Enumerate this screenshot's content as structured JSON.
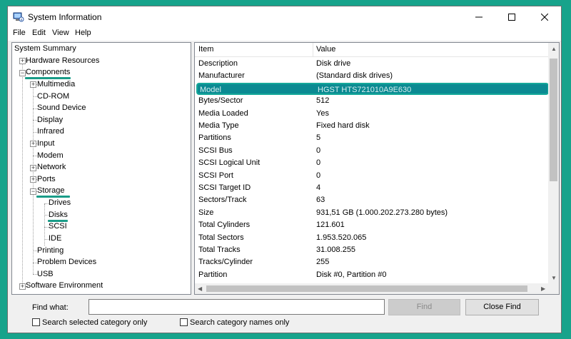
{
  "window": {
    "title": "System Information"
  },
  "menu": {
    "file": "File",
    "edit": "Edit",
    "view": "View",
    "help": "Help"
  },
  "tree": {
    "root": "System Summary",
    "hardware": "Hardware Resources",
    "components": "Components",
    "multimedia": "Multimedia",
    "cdrom": "CD-ROM",
    "sound": "Sound Device",
    "display": "Display",
    "infrared": "Infrared",
    "input": "Input",
    "modem": "Modem",
    "network": "Network",
    "ports": "Ports",
    "storage": "Storage",
    "drives": "Drives",
    "disks": "Disks",
    "scsi": "SCSI",
    "ide": "IDE",
    "printing": "Printing",
    "problem": "Problem Devices",
    "usb": "USB",
    "software": "Software Environment"
  },
  "details": {
    "header_item": "Item",
    "header_value": "Value",
    "rows": [
      {
        "item": "Description",
        "value": "Disk drive"
      },
      {
        "item": "Manufacturer",
        "value": "(Standard disk drives)"
      },
      {
        "item": "Model",
        "value": "HGST HTS721010A9E630"
      },
      {
        "item": "Bytes/Sector",
        "value": "512"
      },
      {
        "item": "Media Loaded",
        "value": "Yes"
      },
      {
        "item": "Media Type",
        "value": "Fixed hard disk"
      },
      {
        "item": "Partitions",
        "value": "5"
      },
      {
        "item": "SCSI Bus",
        "value": "0"
      },
      {
        "item": "SCSI Logical Unit",
        "value": "0"
      },
      {
        "item": "SCSI Port",
        "value": "0"
      },
      {
        "item": "SCSI Target ID",
        "value": "4"
      },
      {
        "item": "Sectors/Track",
        "value": "63"
      },
      {
        "item": "Size",
        "value": "931,51 GB (1.000.202.273.280 bytes)"
      },
      {
        "item": "Total Cylinders",
        "value": "121.601"
      },
      {
        "item": "Total Sectors",
        "value": "1.953.520.065"
      },
      {
        "item": "Total Tracks",
        "value": "31.008.255"
      },
      {
        "item": "Tracks/Cylinder",
        "value": "255"
      },
      {
        "item": "Partition",
        "value": "Disk #0, Partition #0"
      }
    ]
  },
  "find": {
    "label": "Find what:",
    "value": "",
    "find_button": "Find",
    "close_button": "Close Find",
    "check_selected": "Search selected category only",
    "check_names": "Search category names only"
  },
  "colors": {
    "background": "#17a38b",
    "selection": "#0b8a92",
    "highlight": "#1a9c88"
  }
}
